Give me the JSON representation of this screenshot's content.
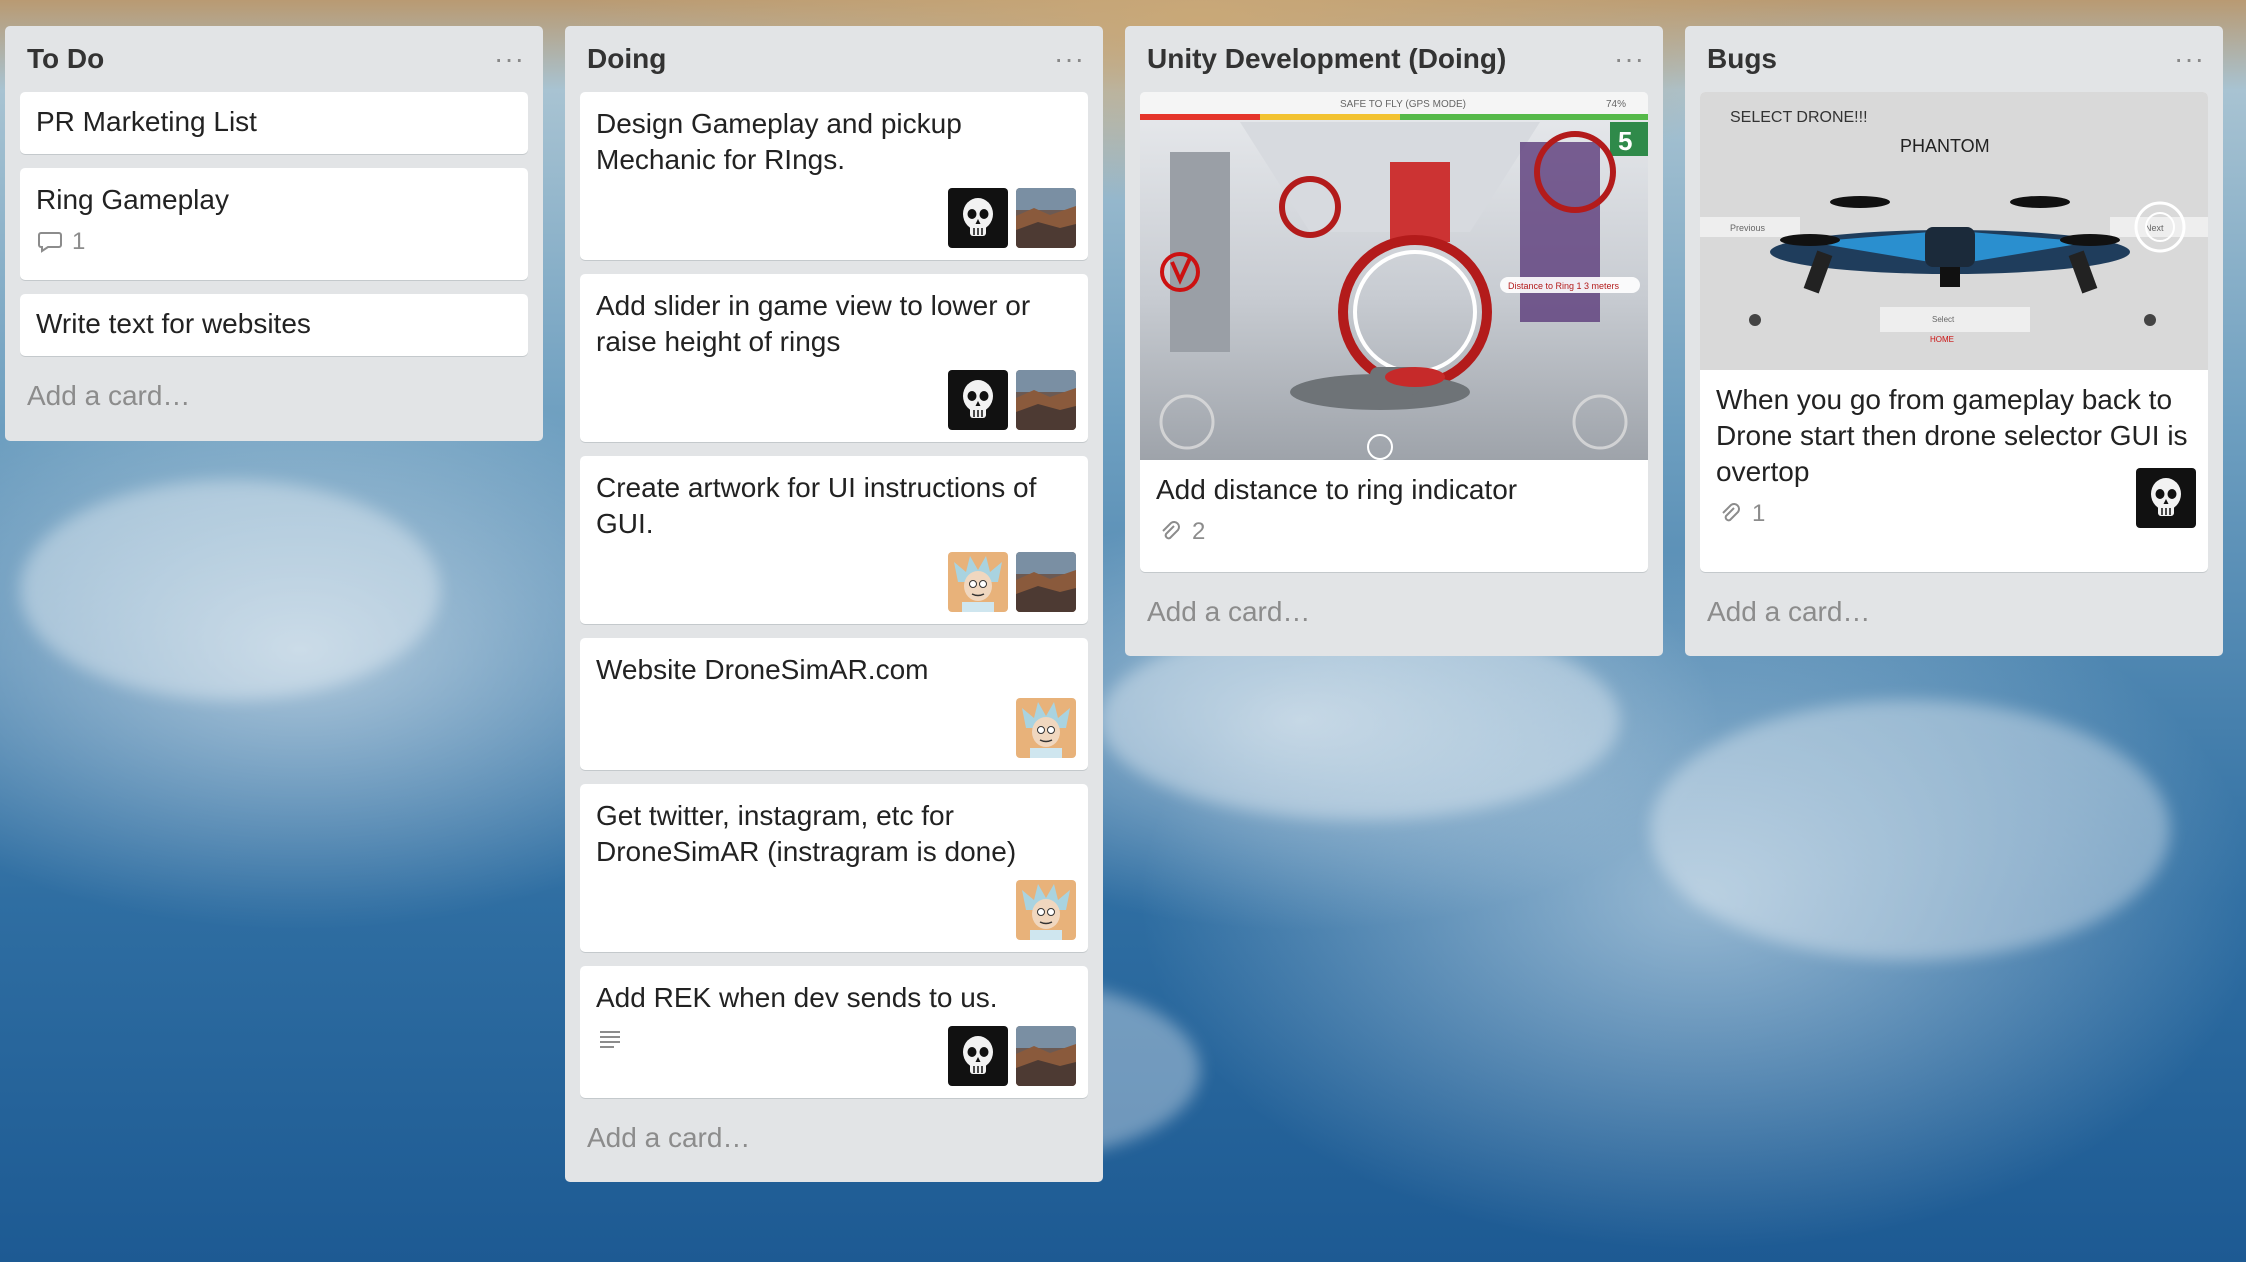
{
  "lists": [
    {
      "title": "To Do",
      "menu": "···",
      "add_card": "Add a card…",
      "cards": [
        {
          "title": "PR Marketing List"
        },
        {
          "title": "Ring Gameplay",
          "comments": "1"
        },
        {
          "title": "Write text for websites"
        }
      ]
    },
    {
      "title": "Doing",
      "menu": "···",
      "add_card": "Add a card…",
      "cards": [
        {
          "title": "Design Gameplay and pickup Mechanic for RIngs."
        },
        {
          "title": "Add slider in game view to lower or raise height of rings"
        },
        {
          "title": "Create artwork for UI instructions of GUI."
        },
        {
          "title": "Website DroneSimAR.com"
        },
        {
          "title": "Get twitter, instagram, etc for DroneSimAR (instragram is done)"
        },
        {
          "title": "Add REK when dev sends to us."
        }
      ]
    },
    {
      "title": "Unity Development (Doing)",
      "menu": "···",
      "add_card": "Add a card…",
      "cards": [
        {
          "title": "Add distance to ring indicator",
          "attachments": "2",
          "cover": {
            "status_text": "SAFE TO FLY (GPS MODE)",
            "battery": "74%",
            "counter": "5",
            "distance_label": "Distance to Ring 1 3 meters"
          }
        }
      ]
    },
    {
      "title": "Bugs",
      "menu": "···",
      "add_card": "Add a card…",
      "cards": [
        {
          "title": "When you go from gameplay back to Drone start then drone selector GUI is overtop",
          "attachments": "1",
          "cover": {
            "heading": "SELECT DRONE!!!",
            "drone_name": "PHANTOM",
            "prev_label": "Previous",
            "next_label": "Next",
            "select_label": "Select",
            "home_label": "HOME"
          }
        }
      ]
    }
  ],
  "colors": {
    "list_bg": "#e2e4e6",
    "card_bg": "#ffffff",
    "muted_text": "#8c8c8c"
  },
  "icons": [
    "comment-icon",
    "attachment-icon",
    "description-icon",
    "skull-avatar",
    "rick-avatar",
    "landscape-avatar"
  ]
}
